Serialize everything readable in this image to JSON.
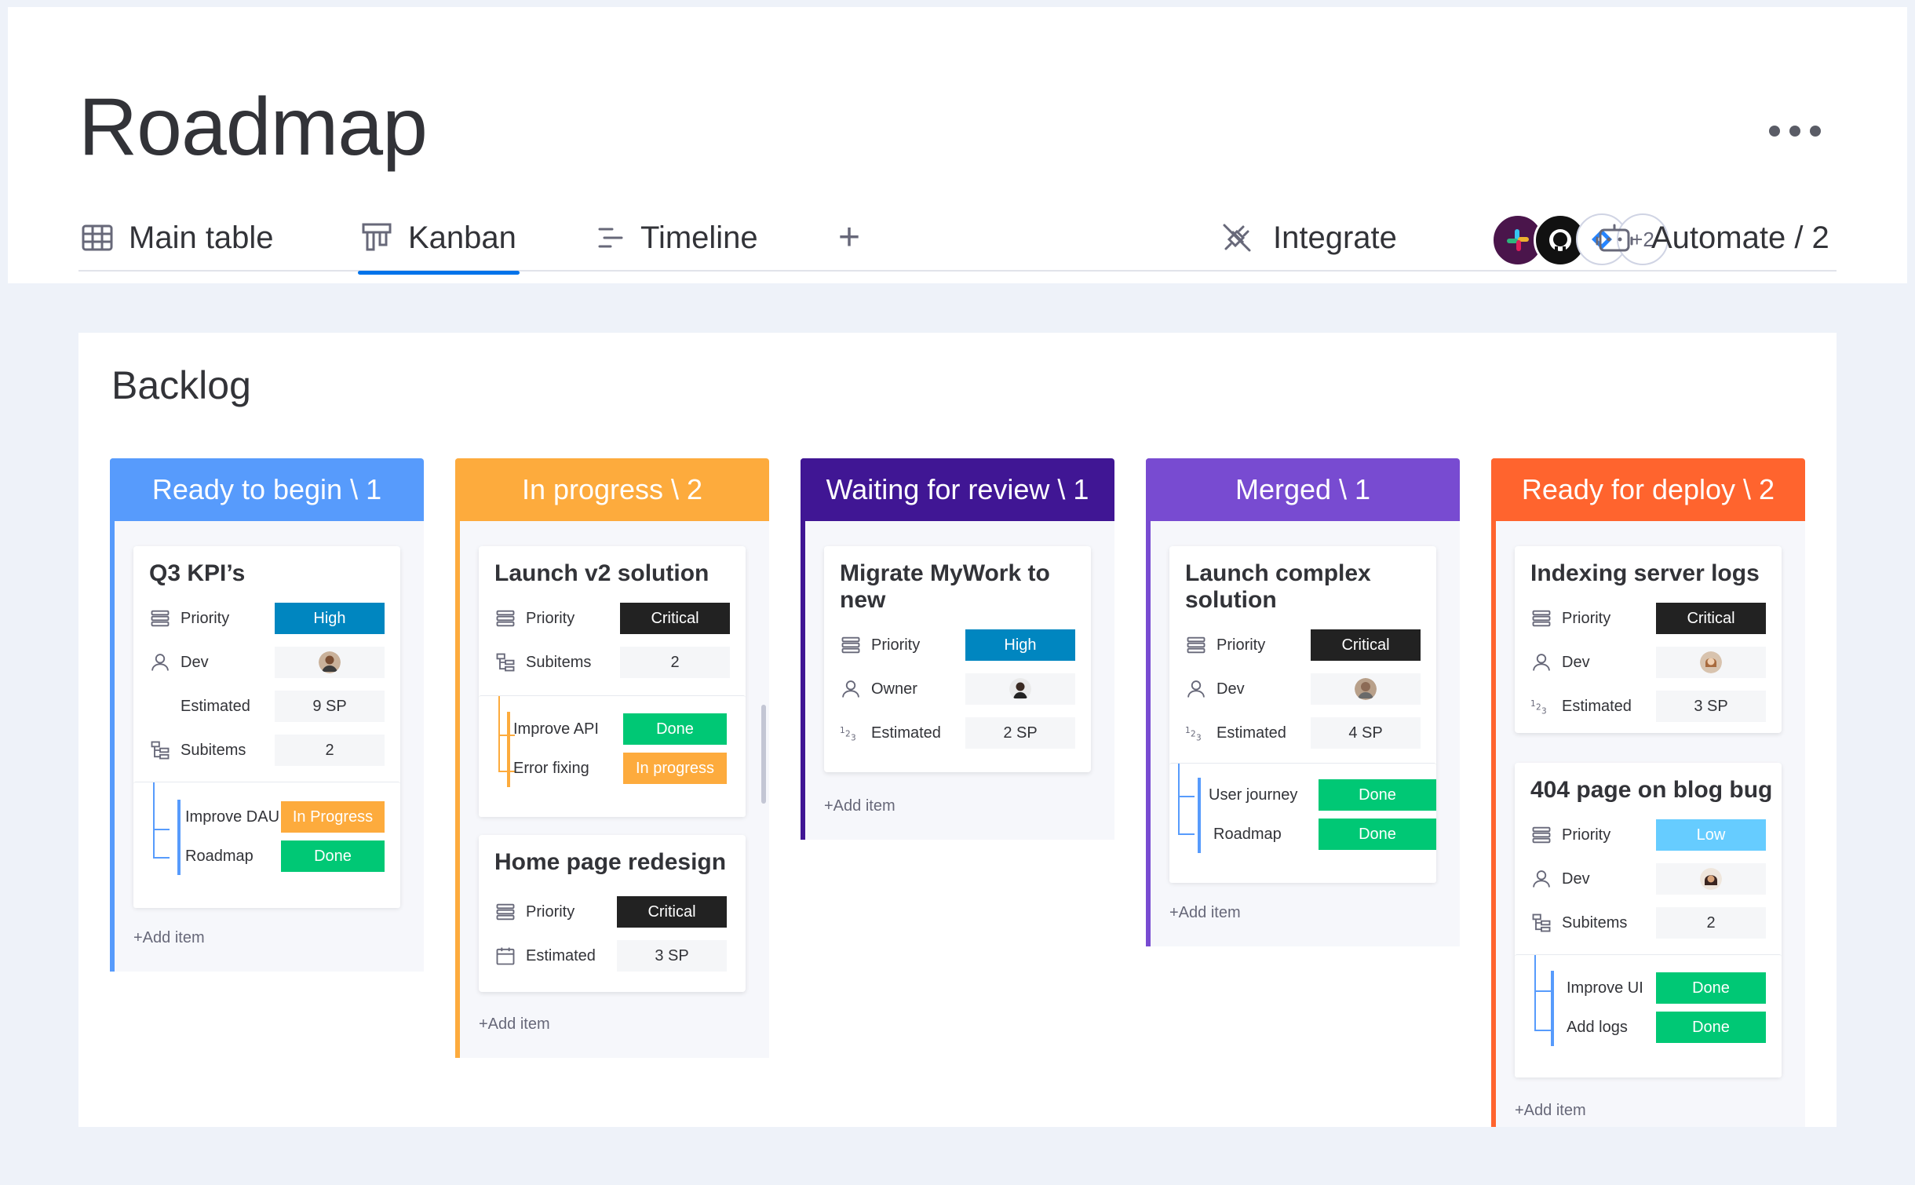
{
  "page": {
    "title": "Roadmap"
  },
  "tabs": [
    {
      "label": "Main table",
      "icon": "table-icon"
    },
    {
      "label": "Kanban",
      "icon": "kanban-icon",
      "active": true
    },
    {
      "label": "Timeline",
      "icon": "timeline-icon"
    }
  ],
  "toolbar": {
    "add_view": "+",
    "integrate": "Integrate",
    "apps_more": "+2",
    "automate": "Automate / 2"
  },
  "board": {
    "title": "Backlog",
    "add_item": "+Add item"
  },
  "colors": {
    "blue": "#579bfc",
    "orange": "#fdab3d",
    "indigo": "#401694",
    "purple": "#784bd1",
    "red": "#ff642e",
    "high": "#0086c0",
    "critical": "#222222",
    "low": "#66ccff",
    "done": "#00c875",
    "progress": "#fdab3d"
  },
  "columns": [
    {
      "header": "Ready to begin \\ 1",
      "cards": [
        {
          "title": "Q3 KPI’s",
          "fields": [
            {
              "label": "Priority",
              "value": "High"
            },
            {
              "label": "Dev",
              "value": ""
            },
            {
              "label": "Estimated",
              "value": "9 SP"
            },
            {
              "label": "Subitems",
              "value": "2"
            }
          ],
          "subitems": [
            {
              "name": "Improve DAU",
              "status": "In Progress"
            },
            {
              "name": "Roadmap",
              "status": "Done"
            }
          ]
        }
      ]
    },
    {
      "header": "In progress \\ 2",
      "cards": [
        {
          "title": "Launch v2 solution",
          "fields": [
            {
              "label": "Priority",
              "value": "Critical"
            },
            {
              "label": "Subitems",
              "value": "2"
            }
          ],
          "subitems": [
            {
              "name": "Improve API",
              "status": "Done"
            },
            {
              "name": "Error fixing",
              "status": "In progress"
            }
          ]
        },
        {
          "title": "Home page redesign",
          "fields": [
            {
              "label": "Priority",
              "value": "Critical"
            },
            {
              "label": "Estimated",
              "value": "3 SP"
            }
          ]
        }
      ]
    },
    {
      "header": "Waiting for review \\ 1",
      "cards": [
        {
          "title": "Migrate MyWork to new",
          "fields": [
            {
              "label": "Priority",
              "value": "High"
            },
            {
              "label": "Owner",
              "value": ""
            },
            {
              "label": "Estimated",
              "value": "2 SP"
            }
          ]
        }
      ]
    },
    {
      "header": "Merged \\ 1",
      "cards": [
        {
          "title": "Launch complex solution",
          "fields": [
            {
              "label": "Priority",
              "value": "Critical"
            },
            {
              "label": "Dev",
              "value": ""
            },
            {
              "label": "Estimated",
              "value": "4 SP"
            }
          ],
          "subitems": [
            {
              "name": "User journey",
              "status": "Done"
            },
            {
              "name": "Roadmap",
              "status": "Done"
            }
          ]
        }
      ]
    },
    {
      "header": "Ready for deploy \\ 2",
      "cards": [
        {
          "title": "Indexing server logs",
          "fields": [
            {
              "label": "Priority",
              "value": "Critical"
            },
            {
              "label": "Dev",
              "value": ""
            },
            {
              "label": "Estimated",
              "value": "3 SP"
            }
          ]
        },
        {
          "title": "404 page on blog bug",
          "fields": [
            {
              "label": "Priority",
              "value": "Low"
            },
            {
              "label": "Dev",
              "value": ""
            },
            {
              "label": "Subitems",
              "value": "2"
            }
          ],
          "subitems": [
            {
              "name": "Improve UI",
              "status": "Done"
            },
            {
              "name": "Add logs",
              "status": "Done"
            }
          ]
        }
      ]
    }
  ]
}
